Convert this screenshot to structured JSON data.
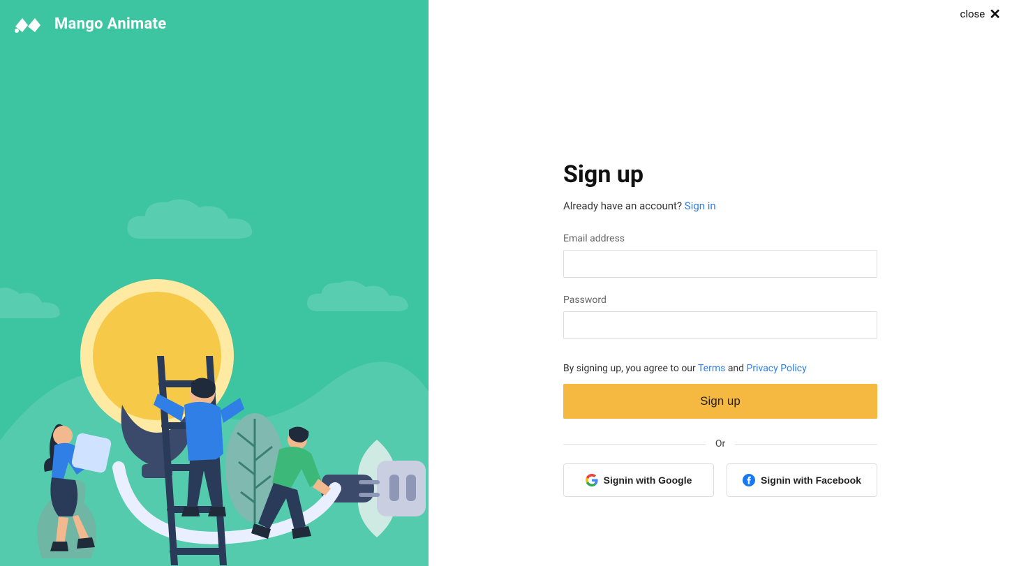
{
  "brand": {
    "name": "Mango Animate"
  },
  "close": {
    "label": "close"
  },
  "form": {
    "title": "Sign up",
    "already_text": "Already have an account? ",
    "signin_link": "Sign in",
    "email_label": "Email address",
    "password_label": "Password",
    "agree_prefix": "By signing up, you agree to our ",
    "terms_label": "Terms",
    "agree_and": " and ",
    "privacy_label": "Privacy Policy",
    "submit_label": "Sign up",
    "or_label": "Or",
    "google_label": "Signin with Google",
    "facebook_label": "Signin with Facebook"
  }
}
